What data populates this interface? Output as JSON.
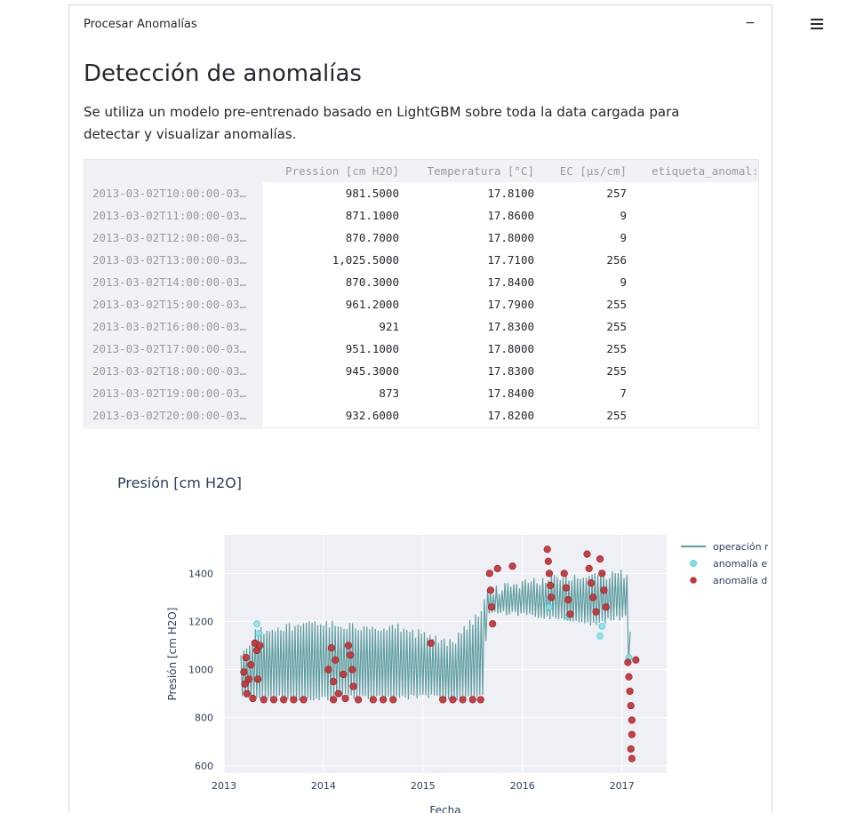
{
  "menu": {
    "icon": "hamburger-menu-icon"
  },
  "expander": {
    "title": "Procesar Anomalías",
    "toggle": "−"
  },
  "section": {
    "heading": "Detección de anomalías",
    "description": "Se utiliza un modelo pre-entrenado basado en LightGBM sobre toda la data cargada para detectar y visualizar anomalías."
  },
  "table": {
    "columns": [
      "Pression [cm H2O]",
      "Temperatura [°C]",
      "EC [µs/cm]",
      "etiqueta_anomal:"
    ],
    "rows": [
      {
        "index": "2013-03-02T10:00:00-03…",
        "pression": "981.5000",
        "temperatura": "17.8100",
        "ec": "257"
      },
      {
        "index": "2013-03-02T11:00:00-03…",
        "pression": "871.1000",
        "temperatura": "17.8600",
        "ec": "9"
      },
      {
        "index": "2013-03-02T12:00:00-03…",
        "pression": "870.7000",
        "temperatura": "17.8000",
        "ec": "9"
      },
      {
        "index": "2013-03-02T13:00:00-03…",
        "pression": "1,025.5000",
        "temperatura": "17.7100",
        "ec": "256"
      },
      {
        "index": "2013-03-02T14:00:00-03…",
        "pression": "870.3000",
        "temperatura": "17.8400",
        "ec": "9"
      },
      {
        "index": "2013-03-02T15:00:00-03…",
        "pression": "961.2000",
        "temperatura": "17.7900",
        "ec": "255"
      },
      {
        "index": "2013-03-02T16:00:00-03…",
        "pression": "921",
        "temperatura": "17.8300",
        "ec": "255"
      },
      {
        "index": "2013-03-02T17:00:00-03…",
        "pression": "951.1000",
        "temperatura": "17.8000",
        "ec": "255"
      },
      {
        "index": "2013-03-02T18:00:00-03…",
        "pression": "945.3000",
        "temperatura": "17.8300",
        "ec": "255"
      },
      {
        "index": "2013-03-02T19:00:00-03…",
        "pression": "873",
        "temperatura": "17.8400",
        "ec": "7"
      },
      {
        "index": "2013-03-02T20:00:00-03…",
        "pression": "932.6000",
        "temperatura": "17.8200",
        "ec": "255"
      }
    ]
  },
  "chart_data": {
    "type": "line",
    "title": "Presión [cm H2O]",
    "xlabel": "Fecha",
    "ylabel": "Presión [cm H2O]",
    "x_ticks": [
      "2013",
      "2014",
      "2015",
      "2016",
      "2017"
    ],
    "y_ticks": [
      600,
      800,
      1000,
      1200,
      1400
    ],
    "xlim": [
      2013.0,
      2017.45
    ],
    "ylim": [
      570,
      1560
    ],
    "grid": true,
    "legend_position": "right",
    "colors": {
      "normal": "#5f9ea0",
      "labeled": "#7fe3e6",
      "detected": "#c8343a",
      "plot_bg": "#eef0f5"
    },
    "series": [
      {
        "name": "operación normal",
        "band": [
          {
            "x": 2013.17,
            "low": 870,
            "high": 1060
          },
          {
            "x": 2013.33,
            "low": 880,
            "high": 1180
          },
          {
            "x": 2013.6,
            "low": 870,
            "high": 1200
          },
          {
            "x": 2014.0,
            "low": 870,
            "high": 1210
          },
          {
            "x": 2014.25,
            "low": 880,
            "high": 1200
          },
          {
            "x": 2014.75,
            "low": 870,
            "high": 1200
          },
          {
            "x": 2015.0,
            "low": 880,
            "high": 1160
          },
          {
            "x": 2015.3,
            "low": 870,
            "high": 1130
          },
          {
            "x": 2015.6,
            "low": 880,
            "high": 1270
          },
          {
            "x": 2015.65,
            "low": 1230,
            "high": 1340
          },
          {
            "x": 2016.0,
            "low": 1220,
            "high": 1380
          },
          {
            "x": 2016.35,
            "low": 1200,
            "high": 1400
          },
          {
            "x": 2016.7,
            "low": 1180,
            "high": 1410
          },
          {
            "x": 2017.05,
            "low": 1210,
            "high": 1420
          },
          {
            "x": 2017.1,
            "low": 640,
            "high": 1050
          }
        ]
      },
      {
        "name": "anomalía etiquetada",
        "points": [
          {
            "x": 2013.33,
            "y": 1190
          },
          {
            "x": 2013.35,
            "y": 1150
          },
          {
            "x": 2013.34,
            "y": 1080
          },
          {
            "x": 2016.27,
            "y": 1260
          },
          {
            "x": 2016.46,
            "y": 1220
          },
          {
            "x": 2016.78,
            "y": 1140
          },
          {
            "x": 2016.8,
            "y": 1180
          },
          {
            "x": 2017.07,
            "y": 1050
          }
        ]
      },
      {
        "name": "anomalía detectada",
        "points": [
          {
            "x": 2013.2,
            "y": 990
          },
          {
            "x": 2013.21,
            "y": 940
          },
          {
            "x": 2013.22,
            "y": 1050
          },
          {
            "x": 2013.23,
            "y": 900
          },
          {
            "x": 2013.25,
            "y": 960
          },
          {
            "x": 2013.27,
            "y": 1020
          },
          {
            "x": 2013.29,
            "y": 880
          },
          {
            "x": 2013.31,
            "y": 1110
          },
          {
            "x": 2013.33,
            "y": 1080
          },
          {
            "x": 2013.34,
            "y": 960
          },
          {
            "x": 2013.36,
            "y": 1100
          },
          {
            "x": 2013.4,
            "y": 875
          },
          {
            "x": 2013.5,
            "y": 875
          },
          {
            "x": 2013.6,
            "y": 875
          },
          {
            "x": 2013.7,
            "y": 875
          },
          {
            "x": 2013.8,
            "y": 875
          },
          {
            "x": 2014.05,
            "y": 1000
          },
          {
            "x": 2014.08,
            "y": 1090
          },
          {
            "x": 2014.1,
            "y": 950
          },
          {
            "x": 2014.12,
            "y": 1040
          },
          {
            "x": 2014.15,
            "y": 900
          },
          {
            "x": 2014.2,
            "y": 980
          },
          {
            "x": 2014.25,
            "y": 1100
          },
          {
            "x": 2014.27,
            "y": 1060
          },
          {
            "x": 2014.29,
            "y": 1000
          },
          {
            "x": 2014.3,
            "y": 930
          },
          {
            "x": 2014.22,
            "y": 880
          },
          {
            "x": 2014.1,
            "y": 875
          },
          {
            "x": 2014.35,
            "y": 875
          },
          {
            "x": 2014.5,
            "y": 875
          },
          {
            "x": 2014.6,
            "y": 875
          },
          {
            "x": 2014.7,
            "y": 875
          },
          {
            "x": 2015.08,
            "y": 1110
          },
          {
            "x": 2015.2,
            "y": 875
          },
          {
            "x": 2015.3,
            "y": 875
          },
          {
            "x": 2015.4,
            "y": 875
          },
          {
            "x": 2015.5,
            "y": 875
          },
          {
            "x": 2015.58,
            "y": 875
          },
          {
            "x": 2015.67,
            "y": 1400
          },
          {
            "x": 2015.68,
            "y": 1330
          },
          {
            "x": 2015.69,
            "y": 1260
          },
          {
            "x": 2015.7,
            "y": 1190
          },
          {
            "x": 2015.75,
            "y": 1420
          },
          {
            "x": 2015.9,
            "y": 1430
          },
          {
            "x": 2016.25,
            "y": 1500
          },
          {
            "x": 2016.26,
            "y": 1450
          },
          {
            "x": 2016.27,
            "y": 1400
          },
          {
            "x": 2016.28,
            "y": 1350
          },
          {
            "x": 2016.29,
            "y": 1300
          },
          {
            "x": 2016.42,
            "y": 1400
          },
          {
            "x": 2016.44,
            "y": 1340
          },
          {
            "x": 2016.46,
            "y": 1290
          },
          {
            "x": 2016.48,
            "y": 1230
          },
          {
            "x": 2016.65,
            "y": 1480
          },
          {
            "x": 2016.67,
            "y": 1420
          },
          {
            "x": 2016.69,
            "y": 1360
          },
          {
            "x": 2016.71,
            "y": 1300
          },
          {
            "x": 2016.74,
            "y": 1240
          },
          {
            "x": 2016.78,
            "y": 1460
          },
          {
            "x": 2016.8,
            "y": 1400
          },
          {
            "x": 2016.82,
            "y": 1330
          },
          {
            "x": 2016.84,
            "y": 1260
          },
          {
            "x": 2017.06,
            "y": 1030
          },
          {
            "x": 2017.07,
            "y": 970
          },
          {
            "x": 2017.08,
            "y": 910
          },
          {
            "x": 2017.09,
            "y": 850
          },
          {
            "x": 2017.1,
            "y": 790
          },
          {
            "x": 2017.1,
            "y": 730
          },
          {
            "x": 2017.09,
            "y": 670
          },
          {
            "x": 2017.1,
            "y": 630
          },
          {
            "x": 2017.14,
            "y": 1040
          }
        ]
      }
    ]
  }
}
